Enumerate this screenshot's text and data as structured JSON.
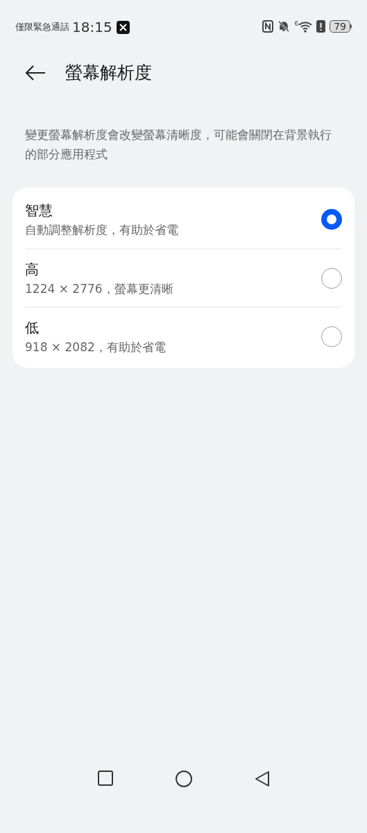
{
  "status_bar": {
    "carrier": "僅限緊急通話",
    "time": "18:15",
    "wifi_label": "6",
    "battery": "79"
  },
  "header": {
    "title": "螢幕解析度"
  },
  "description": "變更螢幕解析度會改變螢幕清晰度，可能會關閉在背景執行的部分應用程式",
  "options": [
    {
      "title": "智慧",
      "subtitle": "自動調整解析度，有助於省電",
      "selected": true
    },
    {
      "title": "高",
      "subtitle": "1224 × 2776，螢幕更清晰",
      "selected": false
    },
    {
      "title": "低",
      "subtitle": "918 × 2082，有助於省電",
      "selected": false
    }
  ]
}
